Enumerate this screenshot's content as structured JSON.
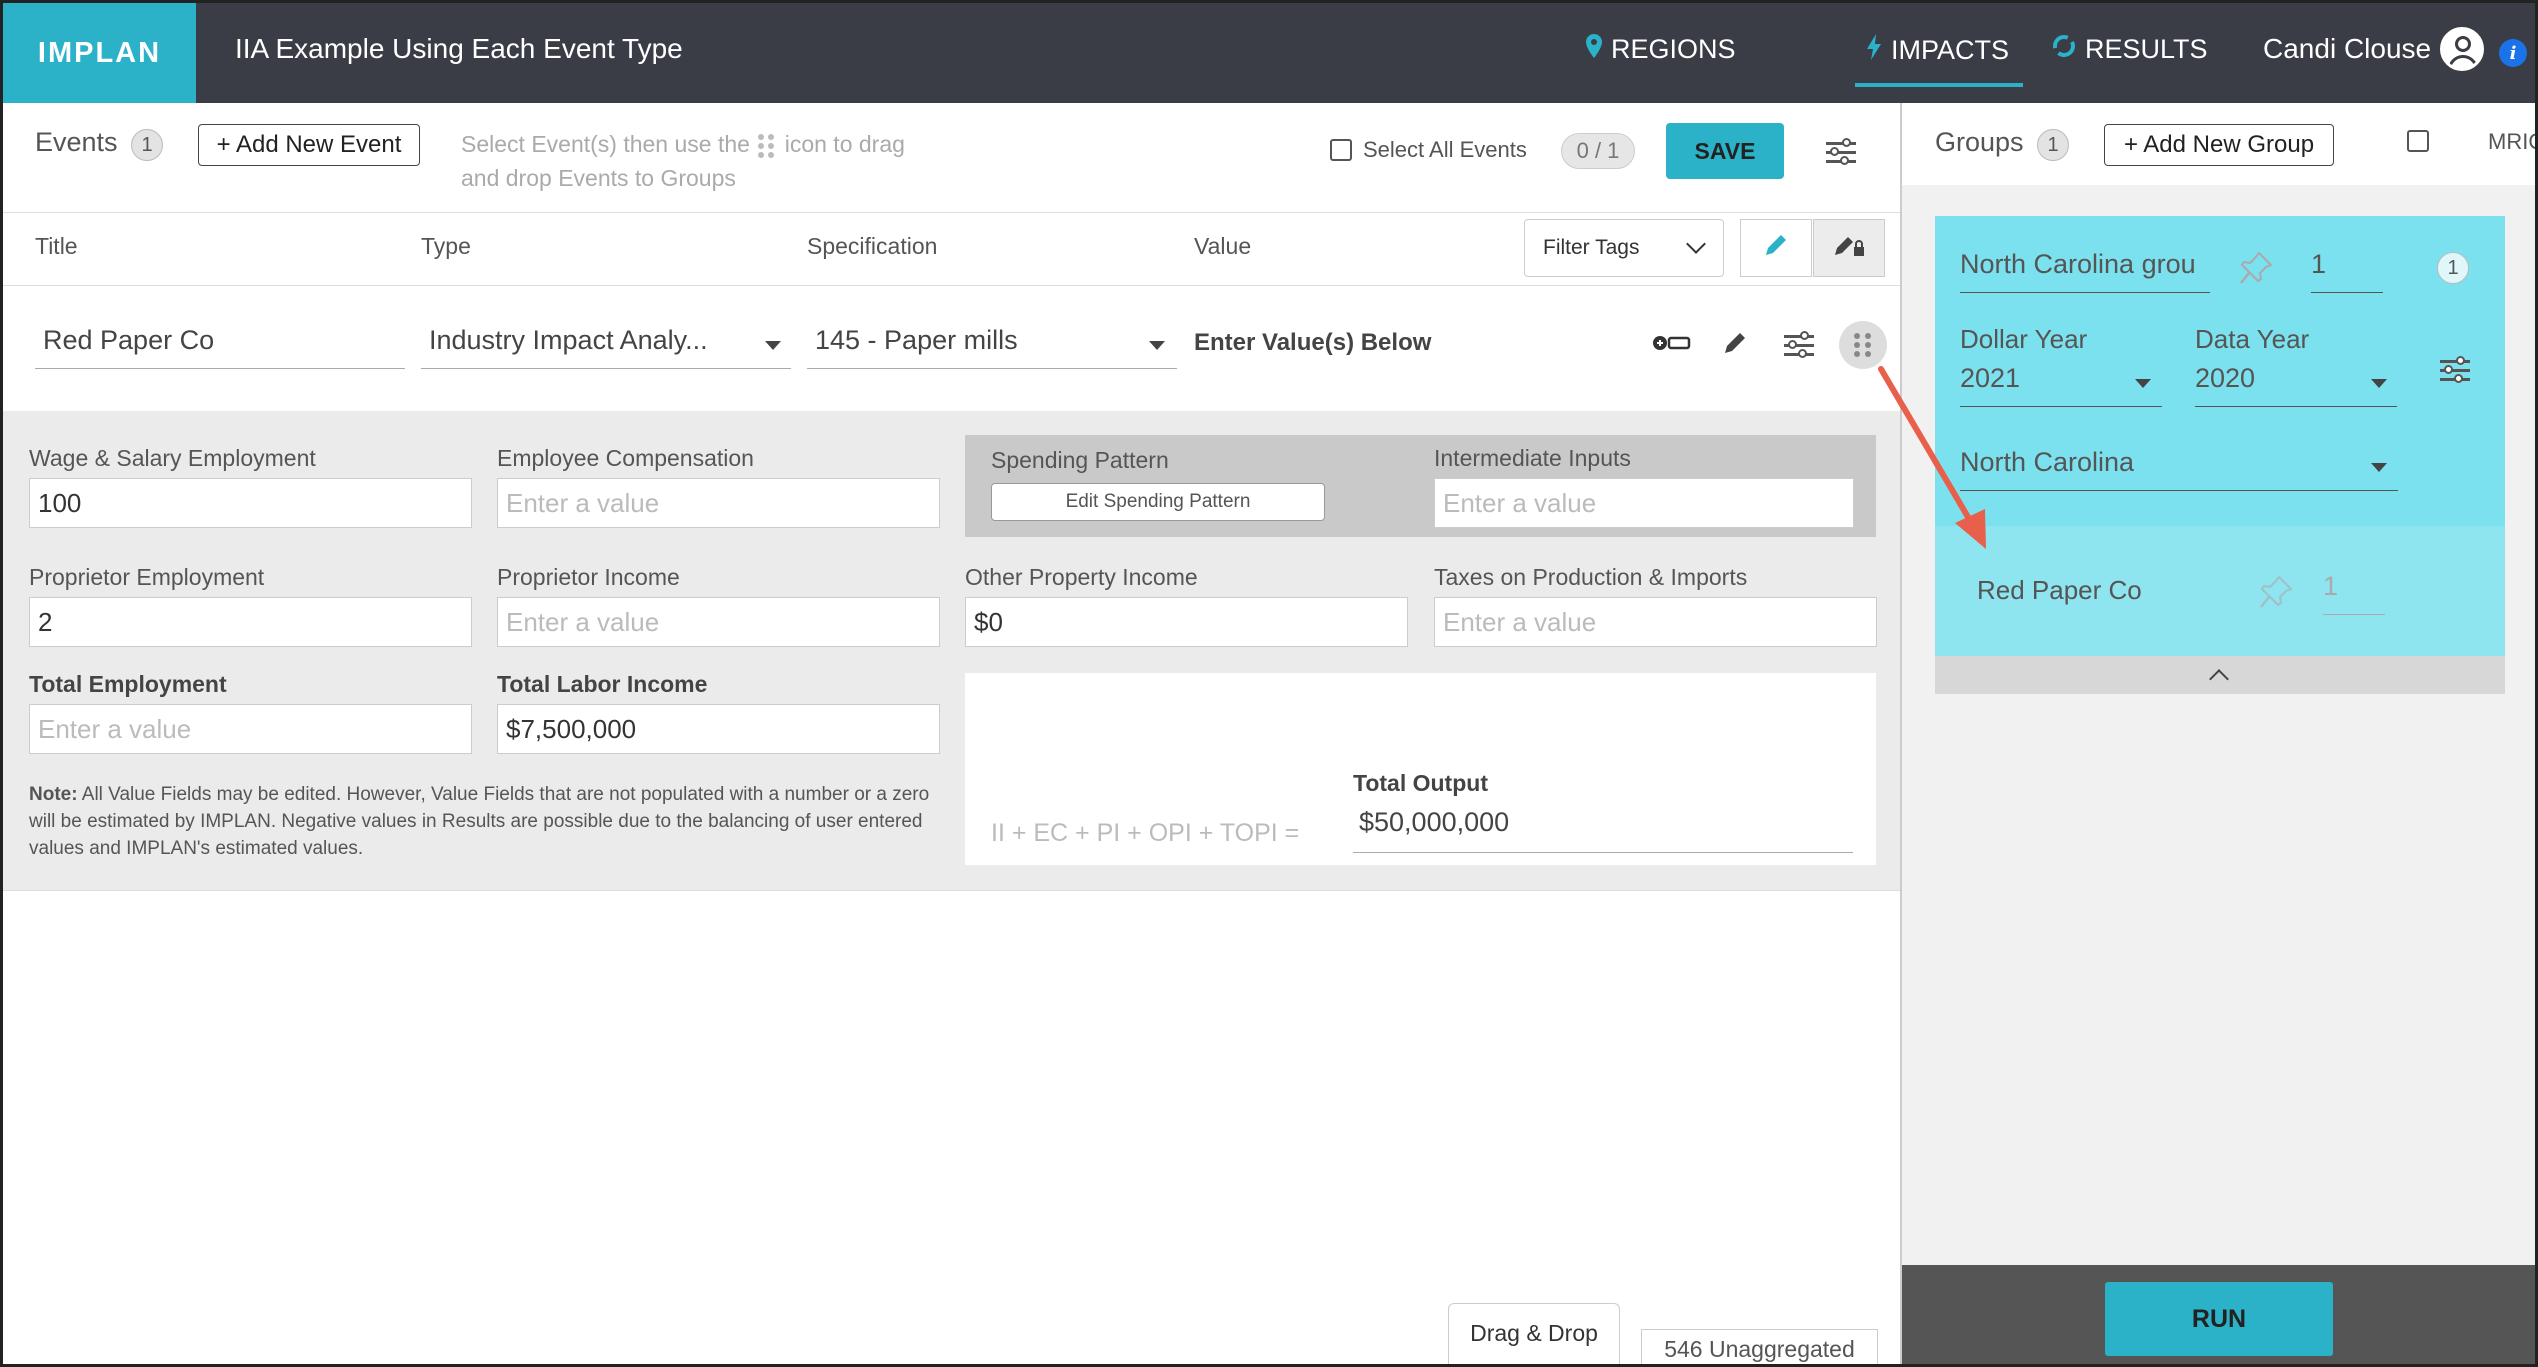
{
  "app": {
    "logo": "IMPLAN",
    "title": "IIA Example Using Each Event Type",
    "nav": [
      {
        "label": "REGIONS",
        "icon": "map-pin-icon"
      },
      {
        "label": "IMPACTS",
        "icon": "lightning-icon"
      },
      {
        "label": "RESULTS",
        "icon": "refresh-icon"
      }
    ],
    "user": "Candi Clouse",
    "info_glyph": "i"
  },
  "events": {
    "label": "Events",
    "count": "1",
    "add_button": "+ Add New Event",
    "hint_before": "Select Event(s) then use the",
    "hint_after": "icon to drag and drop Events to Groups",
    "select_all": "Select All Events",
    "selected_ratio": "0 / 1",
    "save": "SAVE",
    "columns": [
      "Title",
      "Type",
      "Specification",
      "Value"
    ],
    "filter_tags": "Filter Tags"
  },
  "event_row": {
    "title": "Red Paper Co",
    "type": "Industry Impact Analy...",
    "specification": "145 - Paper mills",
    "value": "Enter Value(s) Below"
  },
  "detail": {
    "wage_salary_label": "Wage & Salary Employment",
    "wage_salary_value": "100",
    "employee_comp_label": "Employee Compensation",
    "employee_comp_placeholder": "Enter a value",
    "spending_pattern_label": "Spending Pattern",
    "edit_spending_pattern": "Edit Spending Pattern",
    "intermediate_inputs_label": "Intermediate Inputs",
    "intermediate_inputs_placeholder": "Enter a value",
    "proprietor_emp_label": "Proprietor Employment",
    "proprietor_emp_value": "2",
    "proprietor_income_label": "Proprietor Income",
    "proprietor_income_placeholder": "Enter a value",
    "other_property_label": "Other Property Income",
    "other_property_value": "$0",
    "taxes_label": "Taxes on Production & Imports",
    "taxes_placeholder": "Enter a value",
    "total_emp_label": "Total Employment",
    "total_emp_placeholder": "Enter a value",
    "total_labor_label": "Total Labor Income",
    "total_labor_value": "$7,500,000",
    "note_bold": "Note:",
    "note_text": " All Value Fields may be edited. However, Value Fields that are not populated with a number or a zero will be estimated by IMPLAN. Negative values in Results are possible due to the balancing of user entered values and IMPLAN's estimated values.",
    "formula": "II + EC + PI + OPI + TOPI =",
    "total_output_label": "Total Output",
    "total_output_value": "$50,000,000"
  },
  "bottom": {
    "drag_drop": "Drag & Drop",
    "unaggregated": "546 Unaggregated"
  },
  "groups": {
    "label": "Groups",
    "count": "1",
    "add_button": "+ Add New Group",
    "mrio": "MRIO",
    "group_name": "North Carolina grou",
    "group_scale": "1",
    "group_badge": "1",
    "dollar_year_label": "Dollar Year",
    "dollar_year": "2021",
    "data_year_label": "Data Year",
    "data_year": "2020",
    "region": "North Carolina",
    "event_name": "Red Paper Co",
    "event_scale": "1",
    "run": "RUN"
  },
  "colors": {
    "accent": "#2bb2c9",
    "topbar": "#3a3d46",
    "group_card": "#7ce1ee",
    "annotation_arrow": "#e8604c"
  }
}
